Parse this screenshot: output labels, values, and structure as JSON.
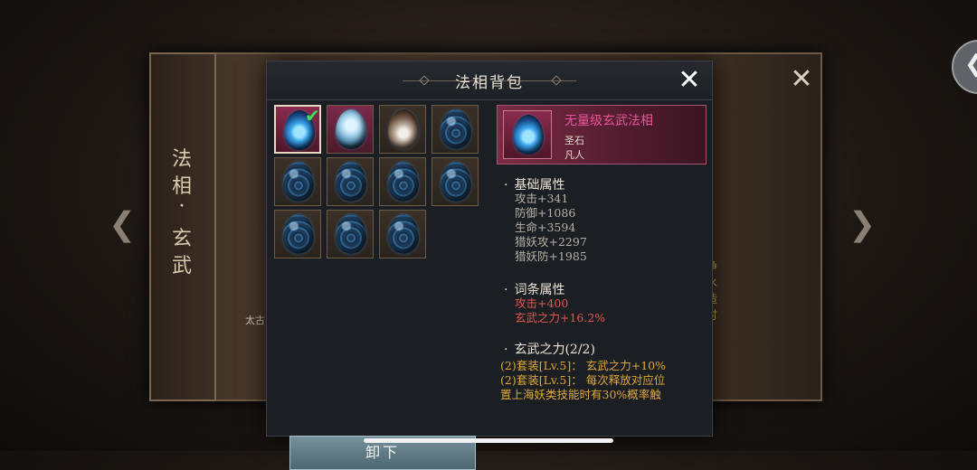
{
  "background": {
    "scroll_title_chars": [
      "法",
      "相",
      "·",
      "玄",
      "武"
    ],
    "side_text_chars": [
      "净",
      "水",
      "造",
      "时",
      "。"
    ],
    "taigu_label": "太古",
    "close_glyph": "✕",
    "left_arrow_glyph": "❮",
    "right_arrow_glyph": "❯",
    "corner_glyph": "❮"
  },
  "dialog": {
    "title": "法相背包",
    "close_glyph": "✕",
    "unequip_label": "卸下",
    "check_glyph": "✔"
  },
  "inventory": {
    "slots": [
      {
        "icon": "flame-egg-icon",
        "selected": true,
        "equipped": true
      },
      {
        "icon": "crystal-egg-icon",
        "selected": false,
        "equipped": false
      },
      {
        "icon": "lotus-egg-icon",
        "selected": false,
        "equipped": false
      },
      {
        "icon": "blue-scale-egg-icon",
        "selected": false,
        "equipped": false
      },
      {
        "icon": "blue-scale-egg-icon",
        "selected": false,
        "equipped": false
      },
      {
        "icon": "blue-scale-egg-icon",
        "selected": false,
        "equipped": false
      },
      {
        "icon": "blue-scale-egg-icon",
        "selected": false,
        "equipped": false
      },
      {
        "icon": "blue-scale-egg-icon",
        "selected": false,
        "equipped": false
      },
      {
        "icon": "blue-scale-egg-icon",
        "selected": false,
        "equipped": false
      },
      {
        "icon": "blue-scale-egg-icon",
        "selected": false,
        "equipped": false
      },
      {
        "icon": "blue-scale-egg-icon",
        "selected": false,
        "equipped": false
      }
    ]
  },
  "detail": {
    "item_name": "无量级玄武法相",
    "item_type": "圣石",
    "item_rank": "凡人",
    "base_title": "基础属性",
    "base_stats": [
      "攻击+341",
      "防御+1086",
      "生命+3594",
      "猎妖攻+2297",
      "猎妖防+1985"
    ],
    "affix_title": "词条属性",
    "affix_stats": [
      "攻击+400",
      "玄武之力+16.2%"
    ],
    "set_title": "玄武之力(2/2)",
    "set_lines": [
      "(2)套装[Lv.5]：  玄武之力+10%",
      "(2)套装[Lv.5]：  每次释放对应位",
      "置上海妖类技能时有30%概率触"
    ]
  },
  "colors": {
    "accent_pink": "#e9559a",
    "affix_red": "#e2564e",
    "set_gold": "#e0a83a",
    "check_green": "#3ee05a"
  }
}
